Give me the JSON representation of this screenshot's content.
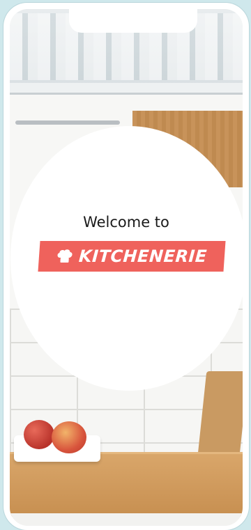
{
  "welcome": {
    "greeting": "Welcome to",
    "brand_name": "KITCHENERIE",
    "brand_color": "#EF625C",
    "brand_icon": "chef-hat-icon"
  },
  "background": {
    "scene": "kitchen-counter-photo"
  }
}
